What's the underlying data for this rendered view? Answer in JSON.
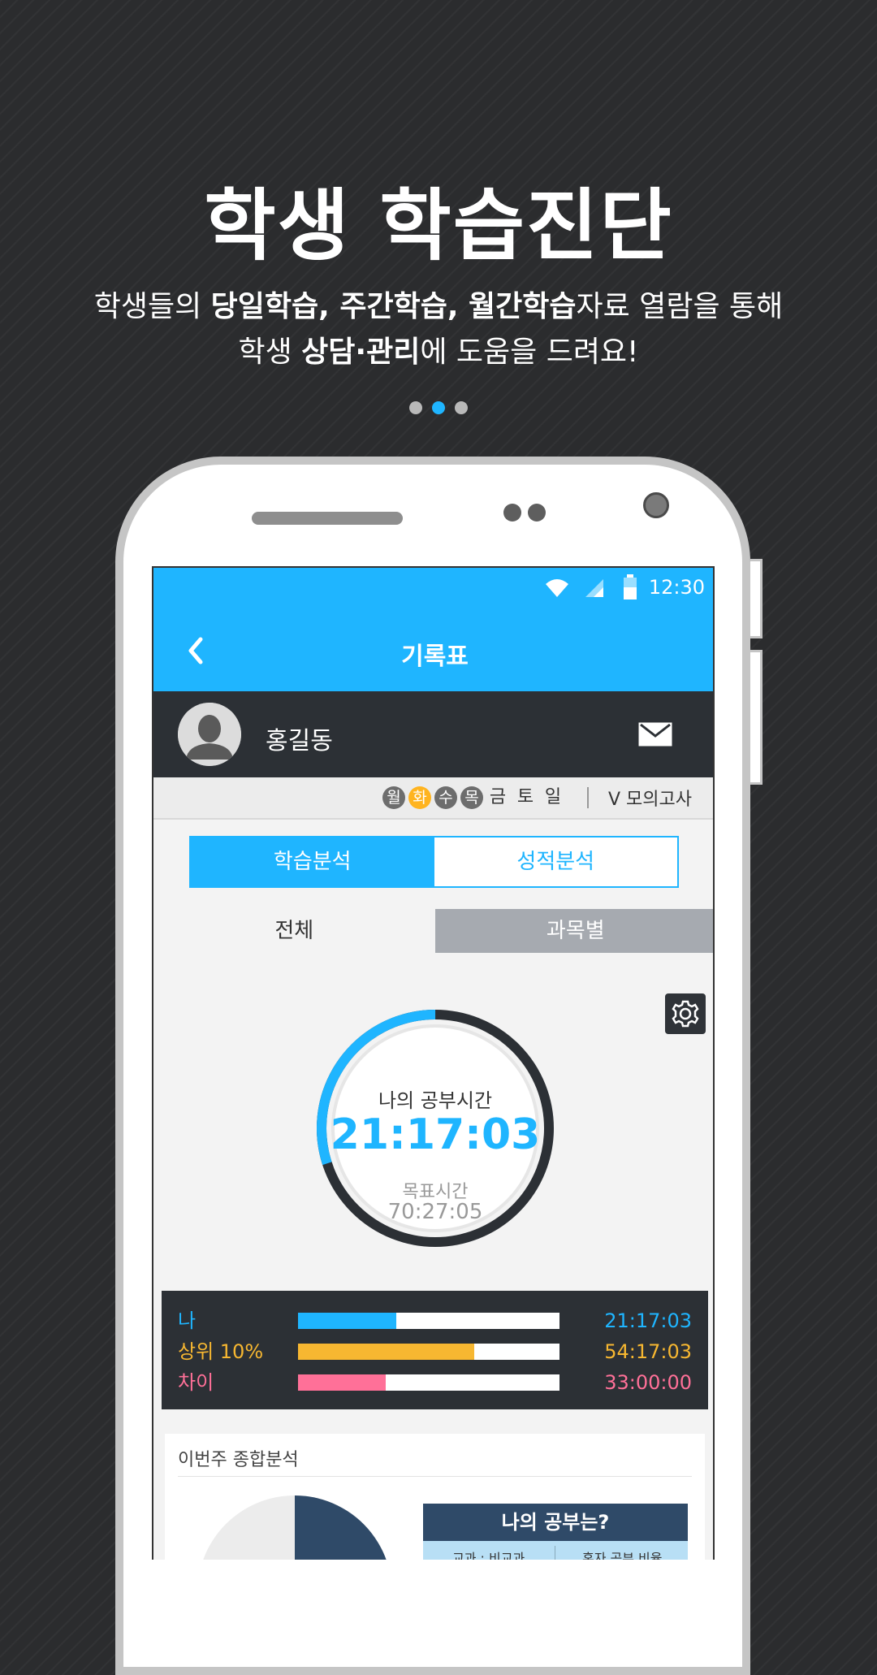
{
  "promo": {
    "title": "학생 학습진단",
    "line1_a": "학생들의 ",
    "line1_b": "당일학습, 주간학습, 월간학습",
    "line1_c": "자료 열람을 통해",
    "line2_a": "학생 ",
    "line2_b": "상담·관리",
    "line2_c": "에 도움을 드려요!",
    "pager_active_index": 1,
    "pager_count": 3
  },
  "status_bar": {
    "time": "12:30"
  },
  "app_bar": {
    "title": "기록표",
    "back_icon": "chevron-left-icon"
  },
  "profile": {
    "name": "홍길동",
    "mail_icon": "mail-icon"
  },
  "days": {
    "items": [
      {
        "label": "월",
        "state": "past"
      },
      {
        "label": "화",
        "state": "today"
      },
      {
        "label": "수",
        "state": "past"
      },
      {
        "label": "목",
        "state": "past"
      },
      {
        "label": "금",
        "state": "future"
      },
      {
        "label": "토",
        "state": "future"
      },
      {
        "label": "일",
        "state": "future"
      }
    ],
    "mock_exam": "V 모의고사"
  },
  "segment": {
    "learning": "학습분석",
    "grades": "성적분석"
  },
  "tabs": {
    "all": "전체",
    "by_subject": "과목별"
  },
  "study_time": {
    "label": "나의 공부시간",
    "value": "21:17:03",
    "goal_label": "목표시간",
    "goal_value": "70:27:05",
    "progress_fraction": 0.3
  },
  "compare": [
    {
      "label": "나",
      "value": "21:17:03",
      "fraction": 0.375,
      "color": "#1fb5ff"
    },
    {
      "label": "상위 10%",
      "value": "54:17:03",
      "fraction": 0.675,
      "color": "#f7b731"
    },
    {
      "label": "차이",
      "value": "33:00:00",
      "fraction": 0.335,
      "color": "#ff7098"
    }
  ],
  "weekly": {
    "title": "이번주 종합분석",
    "my_study_title": "나의 공부는?",
    "col1": "교과 : 비교과",
    "col2": "혼자 공부 비율"
  },
  "colors": {
    "accent": "#1fb5ff",
    "dark": "#2c3035",
    "today": "#ffb41f"
  }
}
